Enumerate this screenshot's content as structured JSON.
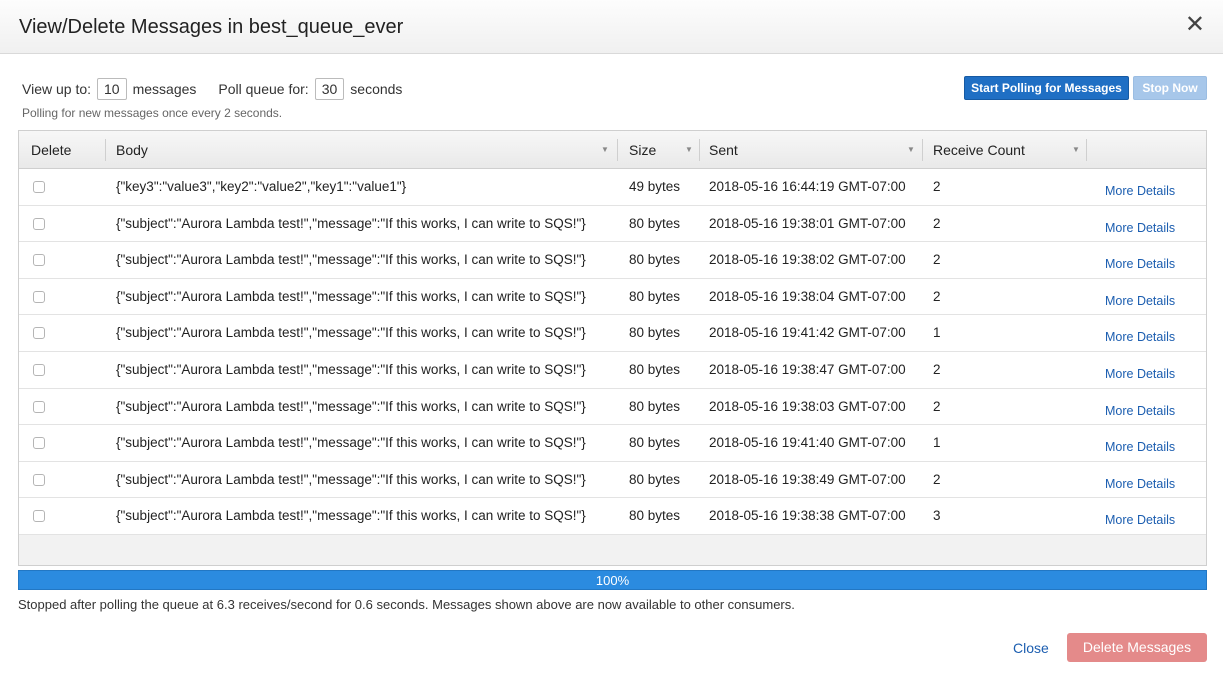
{
  "dialog": {
    "title": "View/Delete Messages in best_queue_ever",
    "close_glyph": "✕"
  },
  "controls": {
    "view_up_to_label": "View up to:",
    "view_up_to_value": "10",
    "messages_label": "messages",
    "poll_queue_label": "Poll queue for:",
    "poll_queue_value": "30",
    "seconds_label": "seconds",
    "polling_note": "Polling for new messages once every 2 seconds.",
    "start_button": "Start Polling for Messages",
    "stop_button": "Stop Now"
  },
  "table": {
    "headers": {
      "delete": "Delete",
      "body": "Body",
      "size": "Size",
      "sent": "Sent",
      "receive_count": "Receive Count"
    },
    "link_label": "More Details",
    "rows": [
      {
        "body": "{\"key3\":\"value3\",\"key2\":\"value2\",\"key1\":\"value1\"}",
        "size": "49 bytes",
        "sent": "2018-05-16 16:44:19 GMT-07:00",
        "count": "2"
      },
      {
        "body": "{\"subject\":\"Aurora Lambda test!\",\"message\":\"If this works, I can write to SQS!\"}",
        "size": "80 bytes",
        "sent": "2018-05-16 19:38:01 GMT-07:00",
        "count": "2"
      },
      {
        "body": "{\"subject\":\"Aurora Lambda test!\",\"message\":\"If this works, I can write to SQS!\"}",
        "size": "80 bytes",
        "sent": "2018-05-16 19:38:02 GMT-07:00",
        "count": "2"
      },
      {
        "body": "{\"subject\":\"Aurora Lambda test!\",\"message\":\"If this works, I can write to SQS!\"}",
        "size": "80 bytes",
        "sent": "2018-05-16 19:38:04 GMT-07:00",
        "count": "2"
      },
      {
        "body": "{\"subject\":\"Aurora Lambda test!\",\"message\":\"If this works, I can write to SQS!\"}",
        "size": "80 bytes",
        "sent": "2018-05-16 19:41:42 GMT-07:00",
        "count": "1"
      },
      {
        "body": "{\"subject\":\"Aurora Lambda test!\",\"message\":\"If this works, I can write to SQS!\"}",
        "size": "80 bytes",
        "sent": "2018-05-16 19:38:47 GMT-07:00",
        "count": "2"
      },
      {
        "body": "{\"subject\":\"Aurora Lambda test!\",\"message\":\"If this works, I can write to SQS!\"}",
        "size": "80 bytes",
        "sent": "2018-05-16 19:38:03 GMT-07:00",
        "count": "2"
      },
      {
        "body": "{\"subject\":\"Aurora Lambda test!\",\"message\":\"If this works, I can write to SQS!\"}",
        "size": "80 bytes",
        "sent": "2018-05-16 19:41:40 GMT-07:00",
        "count": "1"
      },
      {
        "body": "{\"subject\":\"Aurora Lambda test!\",\"message\":\"If this works, I can write to SQS!\"}",
        "size": "80 bytes",
        "sent": "2018-05-16 19:38:49 GMT-07:00",
        "count": "2"
      },
      {
        "body": "{\"subject\":\"Aurora Lambda test!\",\"message\":\"If this works, I can write to SQS!\"}",
        "size": "80 bytes",
        "sent": "2018-05-16 19:38:38 GMT-07:00",
        "count": "3"
      }
    ]
  },
  "progress": {
    "label": "100%",
    "fraction": 1.0,
    "color": "#2b8be0"
  },
  "status_message": "Stopped after polling the queue at 6.3 receives/second for 0.6 seconds. Messages shown above are now available to other consumers.",
  "footer": {
    "close_label": "Close",
    "delete_label": "Delete Messages"
  },
  "colors": {
    "primary_button": "#1f6fc4",
    "disabled_button": "#a7c7ea",
    "danger_disabled": "#e48a8a",
    "link": "#1c5eb0"
  }
}
